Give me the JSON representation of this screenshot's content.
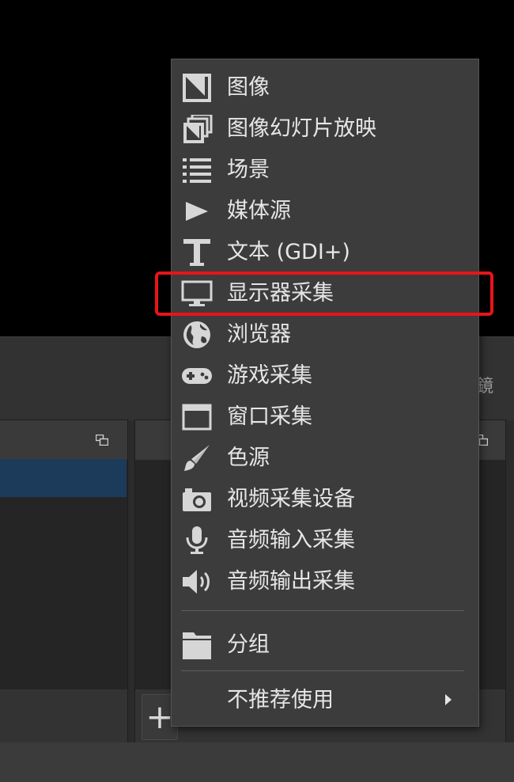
{
  "dock": {
    "partial_label": "鏡"
  },
  "sources_panel": {
    "add_label": "+"
  },
  "menu": {
    "items": [
      {
        "label": "图像",
        "icon": "image-icon"
      },
      {
        "label": "图像幻灯片放映",
        "icon": "image-slideshow-icon"
      },
      {
        "label": "场景",
        "icon": "scene-list-icon"
      },
      {
        "label": "媒体源",
        "icon": "play-icon"
      },
      {
        "label": "文本 (GDI+)",
        "icon": "text-icon"
      },
      {
        "label": "显示器采集",
        "icon": "monitor-icon"
      },
      {
        "label": "浏览器",
        "icon": "globe-icon"
      },
      {
        "label": "游戏采集",
        "icon": "gamepad-icon"
      },
      {
        "label": "窗口采集",
        "icon": "window-icon"
      },
      {
        "label": "色源",
        "icon": "brush-icon"
      },
      {
        "label": "视频采集设备",
        "icon": "camera-icon"
      },
      {
        "label": "音频输入采集",
        "icon": "microphone-icon"
      },
      {
        "label": "音频输出采集",
        "icon": "speaker-icon"
      }
    ],
    "group": {
      "label": "分组",
      "icon": "folder-icon"
    },
    "deprecated": {
      "label": "不推荐使用",
      "icon": "chevron-right-icon"
    }
  },
  "highlight": {
    "color": "#e8141a",
    "target": "显示器采集"
  },
  "colors": {
    "menu_bg": "#3c3c3c",
    "menu_text": "#e6e6e6",
    "selection": "#1c3b5a"
  }
}
